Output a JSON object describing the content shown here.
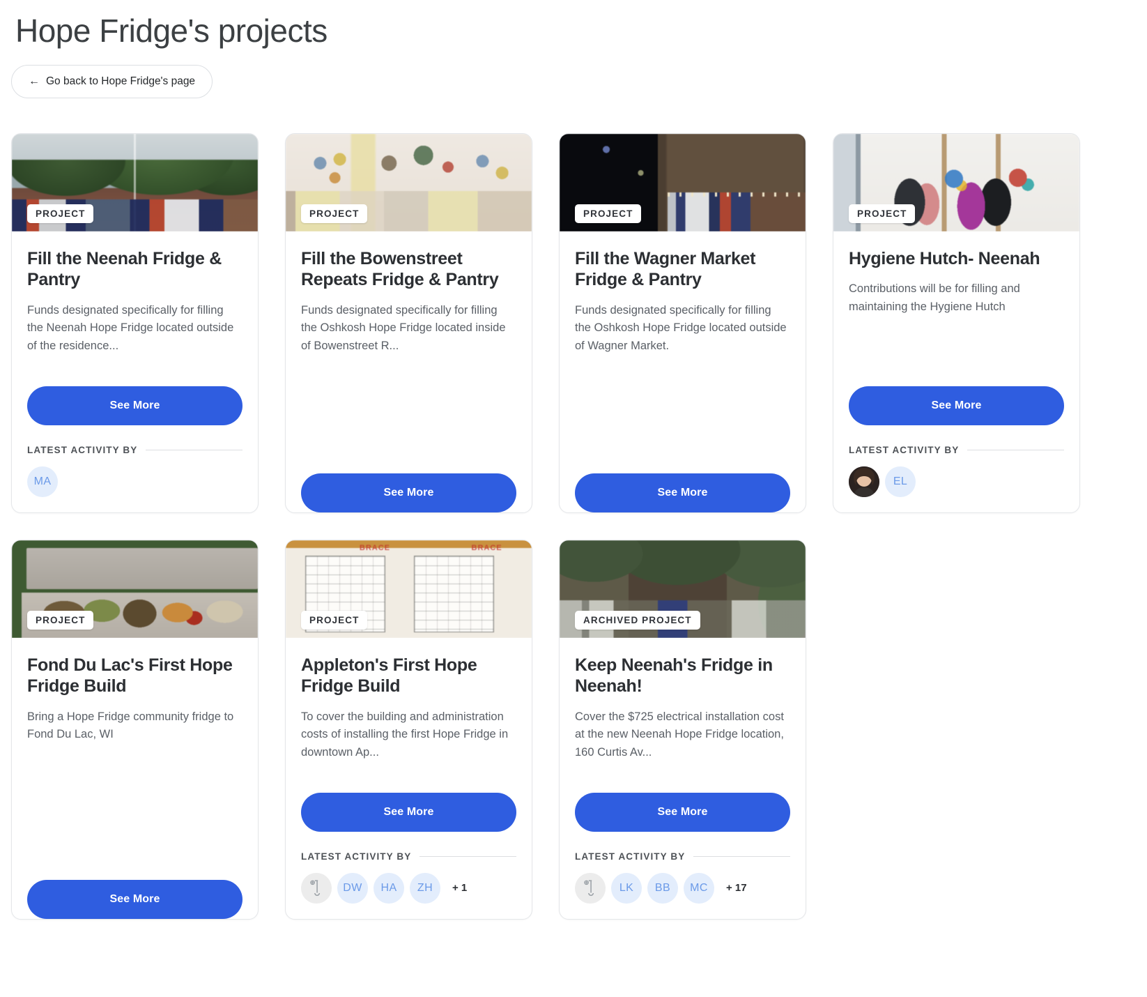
{
  "header": {
    "title": "Hope Fridge's projects",
    "back_button": {
      "label": "Go back to Hope Fridge's page",
      "arrow": "←"
    }
  },
  "labels": {
    "see_more": "See More",
    "latest_activity": "LATEST ACTIVITY BY"
  },
  "colors": {
    "accent_blue": "#2f5de0",
    "avatar_bg": "#e3edfc",
    "avatar_text": "#6b9ae8",
    "title_text": "#2c2f33",
    "body_text": "#5a5f66"
  },
  "cards": [
    {
      "badge": "PROJECT",
      "title": "Fill the Neenah Fridge & Pantry",
      "description": "Funds designated specifically for filling the Neenah Hope Fridge located outside of the residence...",
      "button": "See More",
      "activity_label": "LATEST ACTIVITY BY",
      "has_activity": true,
      "avatars": [
        {
          "type": "initials",
          "text": "MA"
        }
      ],
      "more_count": ""
    },
    {
      "badge": "PROJECT",
      "title": "Fill the Bowenstreet Repeats Fridge & Pantry",
      "description": "Funds designated specifically for filling the Oshkosh Hope Fridge located inside of Bowenstreet R...",
      "button": "See More",
      "activity_label": "",
      "has_activity": false,
      "avatars": [],
      "more_count": ""
    },
    {
      "badge": "PROJECT",
      "title": "Fill the Wagner Market Fridge & Pantry",
      "description": "Funds designated specifically for filling the Oshkosh Hope Fridge located outside of Wagner Market.",
      "button": "See More",
      "activity_label": "",
      "has_activity": false,
      "avatars": [],
      "more_count": ""
    },
    {
      "badge": "PROJECT",
      "title": "Hygiene Hutch- Neenah",
      "description": "Contributions will be for filling and maintaining the Hygiene Hutch",
      "button": "See More",
      "activity_label": "LATEST ACTIVITY BY",
      "has_activity": true,
      "avatars": [
        {
          "type": "photo",
          "text": ""
        },
        {
          "type": "initials",
          "text": "EL"
        }
      ],
      "more_count": ""
    },
    {
      "badge": "PROJECT",
      "title": "Fond Du Lac's First Hope Fridge Build",
      "description": "Bring a Hope Fridge community fridge to Fond Du Lac, WI",
      "button": "See More",
      "activity_label": "",
      "has_activity": false,
      "avatars": [],
      "more_count": ""
    },
    {
      "badge": "PROJECT",
      "title": "Appleton's First Hope Fridge Build",
      "description": "To cover the building and administration costs of installing the first Hope Fridge in downtown Ap...",
      "button": "See More",
      "activity_label": "LATEST ACTIVITY BY",
      "has_activity": true,
      "avatars": [
        {
          "type": "placeholder",
          "text": ""
        },
        {
          "type": "initials",
          "text": "DW"
        },
        {
          "type": "initials",
          "text": "HA"
        },
        {
          "type": "initials",
          "text": "ZH"
        }
      ],
      "more_count": "+ 1"
    },
    {
      "badge": "ARCHIVED PROJECT",
      "title": "Keep Neenah's Fridge in Neenah!",
      "description": "Cover the $725 electrical installation cost at the new Neenah Hope Fridge location, 160 Curtis Av...",
      "button": "See More",
      "activity_label": "LATEST ACTIVITY BY",
      "has_activity": true,
      "avatars": [
        {
          "type": "placeholder",
          "text": ""
        },
        {
          "type": "initials",
          "text": "LK"
        },
        {
          "type": "initials",
          "text": "BB"
        },
        {
          "type": "initials",
          "text": "MC"
        }
      ],
      "more_count": "+ 17"
    }
  ]
}
